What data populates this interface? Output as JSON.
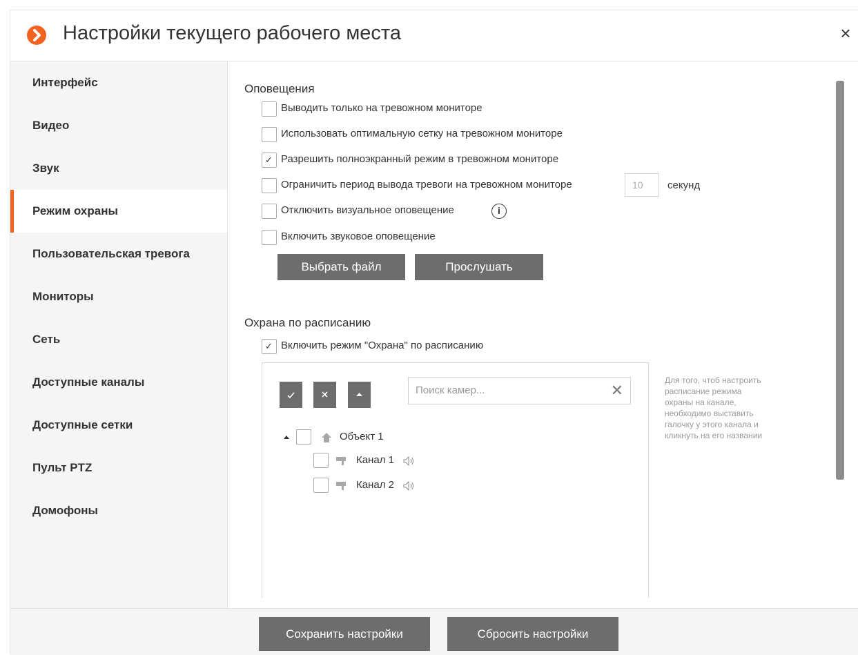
{
  "dialog": {
    "title": "Настройки текущего рабочего места",
    "close_symbol": "×",
    "logo_icon": "macroscop-logo-icon",
    "accent_color": "#f26322"
  },
  "sidebar": {
    "items": [
      {
        "label": "Интерфейс"
      },
      {
        "label": "Видео"
      },
      {
        "label": "Звук"
      },
      {
        "label": "Режим охраны",
        "active": true
      },
      {
        "label": "Пользовательская тревога"
      },
      {
        "label": "Мониторы"
      },
      {
        "label": "Сеть"
      },
      {
        "label": "Доступные каналы"
      },
      {
        "label": "Доступные сетки"
      },
      {
        "label": "Пульт PTZ"
      },
      {
        "label": "Домофоны"
      }
    ]
  },
  "alerts": {
    "title": "Оповещения",
    "options": [
      {
        "label": "Выводить только на тревожном мониторе",
        "checked": false
      },
      {
        "label": "Использовать оптимальную сетку на тревожном мониторе",
        "checked": false
      },
      {
        "label": "Разрешить полноэкранный режим в тревожном мониторе",
        "checked": true
      },
      {
        "label": "Ограничить период вывода тревоги на тревожном мониторе",
        "checked": false
      },
      {
        "label": "Отключить визуальное оповещение",
        "checked": false
      },
      {
        "label": "Включить звуковое оповещение",
        "checked": false
      }
    ],
    "period_value": "10",
    "period_unit": "секунд",
    "info_symbol": "i",
    "choose_file_label": "Выбрать файл",
    "listen_label": "Прослушать"
  },
  "schedule": {
    "title": "Охрана по расписанию",
    "enable_label": "Включить режим \"Охрана\" по расписанию",
    "enable_checked": true,
    "search_placeholder": "Поиск камер...",
    "clear_symbol": "✕",
    "tree": [
      {
        "label": "Объект 1",
        "type": "object",
        "checked": false
      },
      {
        "label": "Канал 1",
        "type": "channel",
        "checked": false
      },
      {
        "label": "Канал 2",
        "type": "channel",
        "checked": false
      }
    ],
    "hint_lines": [
      "Для того, чтоб настроить",
      "расписание режима",
      "охраны на канале,",
      "необходимо выставить",
      "галочку у этого канала и",
      "кликнуть на его названии"
    ]
  },
  "footer": {
    "save_label": "Сохранить настройки",
    "reset_label": "Сбросить настройки"
  },
  "check_mark": "✓"
}
